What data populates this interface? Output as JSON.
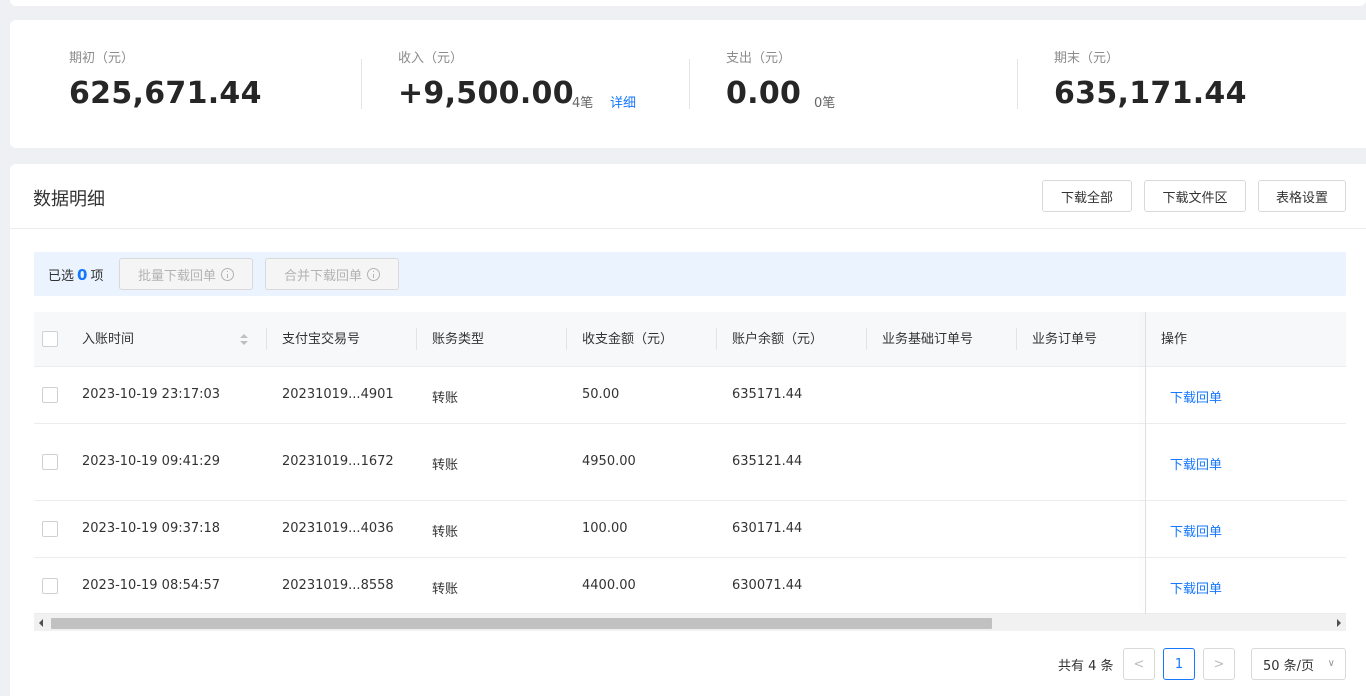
{
  "summary": {
    "opening": {
      "label": "期初（元）",
      "value": "625,671.44"
    },
    "income": {
      "label": "收入（元）",
      "value": "+9,500.00",
      "count": "4笔",
      "link": "详细"
    },
    "expense": {
      "label": "支出（元）",
      "value": "0.00",
      "count": "0笔"
    },
    "closing": {
      "label": "期末（元）",
      "value": "635,171.44"
    }
  },
  "panel": {
    "title": "数据明细",
    "buttons": {
      "download_all": "下载全部",
      "download_files": "下载文件区",
      "table_settings": "表格设置"
    }
  },
  "selection": {
    "prefix": "已选",
    "count": "0",
    "suffix": "项",
    "batch_download": "批量下载回单",
    "merge_download": "合并下载回单"
  },
  "table": {
    "headers": {
      "time": "入账时间",
      "trade_no": "支付宝交易号",
      "type": "账务类型",
      "amount": "收支金额（元）",
      "balance": "账户余额（元）",
      "base_order": "业务基础订单号",
      "order": "业务订单号",
      "action": "操作"
    },
    "rows": [
      {
        "time": "2023-10-19 23:17:03",
        "trade_no": "20231019...4901",
        "type": "转账",
        "amount": "50.00",
        "balance": "635171.44",
        "action": "下载回单"
      },
      {
        "time": "2023-10-19 09:41:29",
        "trade_no": "20231019...1672",
        "type": "转账",
        "amount": "4950.00",
        "balance": "635121.44",
        "action": "下载回单"
      },
      {
        "time": "2023-10-19 09:37:18",
        "trade_no": "20231019...4036",
        "type": "转账",
        "amount": "100.00",
        "balance": "630171.44",
        "action": "下载回单"
      },
      {
        "time": "2023-10-19 08:54:57",
        "trade_no": "20231019...8558",
        "type": "转账",
        "amount": "4400.00",
        "balance": "630071.44",
        "action": "下载回单"
      }
    ]
  },
  "pagination": {
    "total": "共有 4 条",
    "prev": "<",
    "current": "1",
    "next": ">",
    "page_size": "50 条/页",
    "page_size_chevron": "∨"
  }
}
